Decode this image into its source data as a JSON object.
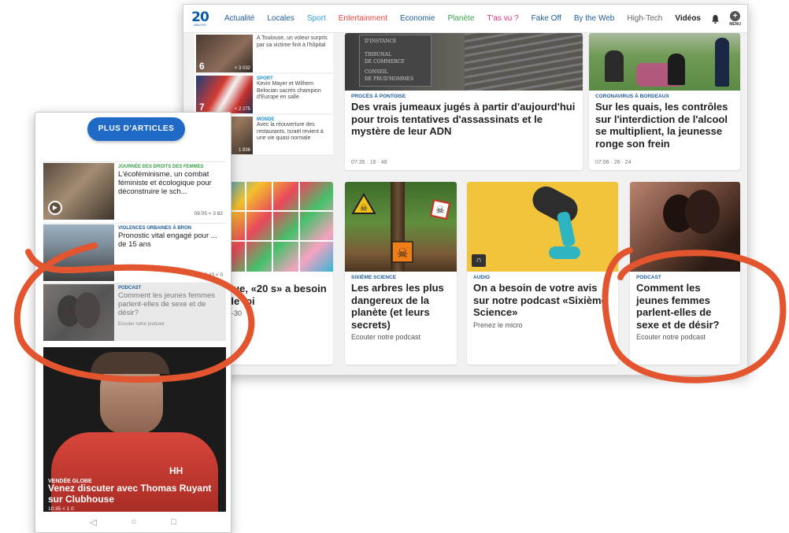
{
  "desktop": {
    "logo_num": "20",
    "logo_sub": "MINUTES",
    "nav": [
      {
        "label": "Actualité",
        "color": "#1e5c9a"
      },
      {
        "label": "Locales",
        "color": "#1e5c9a"
      },
      {
        "label": "Sport",
        "color": "#2ba3e0"
      },
      {
        "label": "Entertainment",
        "color": "#e8423a"
      },
      {
        "label": "Economie",
        "color": "#1e5c9a"
      },
      {
        "label": "Planète",
        "color": "#3aa24a"
      },
      {
        "label": "T'as vu ?",
        "color": "#d6337a"
      },
      {
        "label": "Fake Off",
        "color": "#1e5c9a"
      },
      {
        "label": "By the Web",
        "color": "#1e5c9a"
      },
      {
        "label": "High-Tech",
        "color": "#666666"
      },
      {
        "label": "Vidéos",
        "color": "#222222"
      }
    ],
    "menu_label": "MENU",
    "sidebar": [
      {
        "rank": "6",
        "shares": "< 3 032",
        "category": "",
        "title": "A Toulouse, un voleur surpris par sa victime finit à l'hôpital"
      },
      {
        "rank": "7",
        "shares": "< 2 275",
        "category": "SPORT",
        "title": "Kevin Mayer et Wilhem Belocian sacrés champion d'Europe en salle"
      },
      {
        "rank": "",
        "shares": "1 836",
        "category": "MONDE",
        "title": "Avec la réouverture des restaurants, Israël revient à une vie quasi normale"
      }
    ],
    "top_cards": [
      {
        "category": "PROCÈS À PONTOISE",
        "title": "Des vrais jumeaux jugés à partir d'aujourd'hui pour trois tentatives d'assassinats et le mystère de leur ADN",
        "meta": "07:35 · 16 · 48",
        "sign_lines": [
          "D'INSTANCE",
          "TRIBUNAL",
          "DE COMMERCE",
          "CONSEIL",
          "DE PRUD'HOMMES"
        ]
      },
      {
        "category": "CORONAVIRUS À BORDEAUX",
        "title": "Sur les quais, les contrôles sur l'interdiction de l'alcool se multiplient, la jeunesse ronge son frein",
        "meta": "07:06 · 26 · 24"
      }
    ],
    "bottom_cards": [
      {
        "category": "",
        "title": "eue, «20 s» a besoin de toi",
        "sub": "5-30"
      },
      {
        "category": "SIXIÈME SCIENCE",
        "title": "Les arbres les plus dangereux de la planète (et leurs secrets)",
        "sub": "Ecouter notre podcast"
      },
      {
        "category": "AUDIO",
        "title": "On a besoin de votre avis sur notre podcast «Sixième Science»",
        "sub": "Prenez le micro"
      },
      {
        "category": "PODCAST",
        "title": "Comment les jeunes femmes parlent-elles de sexe et de désir?",
        "sub": "Ecouter notre podcast"
      }
    ]
  },
  "mobile": {
    "more_button": "PLUS D'ARTICLES",
    "rows": [
      {
        "category": "JOURNÉE DES DROITS DES FEMMES",
        "category_color": "#3aa24a",
        "title": "L'écoféminisme, un combat féministe et écologique pour déconstruire le sch...",
        "meta": "09:05  < 3  82",
        "sub": ""
      },
      {
        "category": "VIOLENCES URBAINES À BRON",
        "category_color": "#1e5c9a",
        "title": "Pronostic vital engagé pour ... de 15 ans",
        "meta": "10:43  < 0",
        "sub": ""
      },
      {
        "category": "PODCAST",
        "category_color": "#1e5c9a",
        "title": "Comment les jeunes femmes parlent-elles de sexe et de désir?",
        "meta": "",
        "sub": "Ecouter notre podcast"
      }
    ],
    "hero": {
      "category": "VENDÉE GLOBE",
      "title": "Venez discuter avec Thomas Ruyant sur Clubhouse",
      "meta": "10:35  < 1  0",
      "suit_logo": "HH"
    },
    "navbar": [
      "◁",
      "○",
      "□"
    ]
  },
  "colors": {
    "annotation": "#e2552e",
    "brand": "#1f69c7"
  }
}
